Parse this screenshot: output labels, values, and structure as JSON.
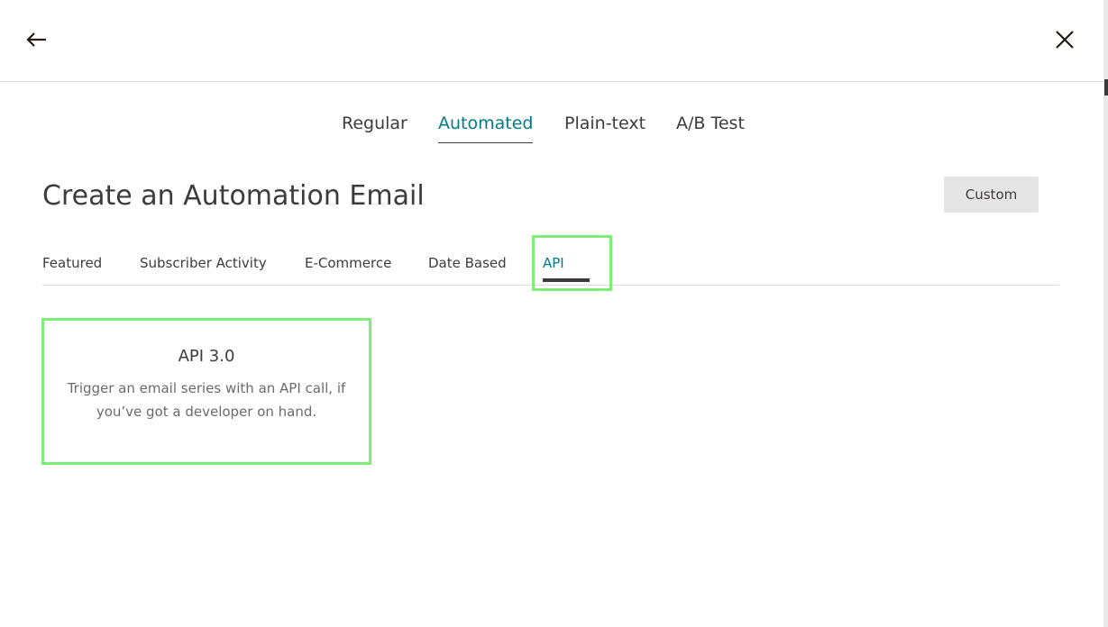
{
  "header": {
    "back_icon": "arrow-left-icon",
    "close_icon": "close-icon"
  },
  "type_tabs": [
    {
      "label": "Regular",
      "active": false
    },
    {
      "label": "Automated",
      "active": true
    },
    {
      "label": "Plain-text",
      "active": false
    },
    {
      "label": "A/B Test",
      "active": false
    }
  ],
  "page": {
    "title": "Create an Automation Email",
    "custom_label": "Custom"
  },
  "category_tabs": [
    {
      "label": "Featured",
      "active": false
    },
    {
      "label": "Subscriber Activity",
      "active": false
    },
    {
      "label": "E-Commerce",
      "active": false
    },
    {
      "label": "Date Based",
      "active": false
    },
    {
      "label": "API",
      "active": true
    }
  ],
  "cards": [
    {
      "title": "API 3.0",
      "description": "Trigger an email series with an API call, if you’ve got a developer on hand."
    }
  ],
  "colors": {
    "accent": "#007c89",
    "highlight": "#7ef07a",
    "text": "#403b3b"
  }
}
